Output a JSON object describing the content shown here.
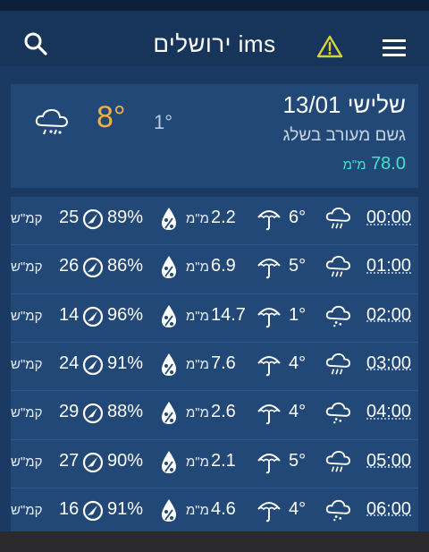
{
  "app": {
    "title": "ims ירושלים",
    "icons": {
      "search": "search-icon",
      "warning": "warning-icon",
      "menu": "menu-icon"
    },
    "colors": {
      "accent_high": "#f3b04a",
      "rain_total": "#3fe6c6",
      "warning": "#d4d33a"
    }
  },
  "summary": {
    "date": "שלישי 13/01",
    "description": "גשם מעורב בשלג",
    "rain_value": "78.0",
    "rain_unit": "מ\"מ",
    "temp_high": "8°",
    "temp_low": "1°",
    "icon": "snow-rain-icon"
  },
  "hours": [
    {
      "time": "00:00",
      "temp": "6°",
      "rain": "2.2",
      "rain_unit": "מ\"מ",
      "humidity": "89%",
      "wind": "25",
      "wind_unit": "קמ\"ש"
    },
    {
      "time": "01:00",
      "temp": "5°",
      "rain": "6.9",
      "rain_unit": "מ\"מ",
      "humidity": "86%",
      "wind": "26",
      "wind_unit": "קמ\"ש"
    },
    {
      "time": "02:00",
      "temp": "1°",
      "rain": "14.7",
      "rain_unit": "מ\"מ",
      "humidity": "96%",
      "wind": "14",
      "wind_unit": "קמ\"ש"
    },
    {
      "time": "03:00",
      "temp": "4°",
      "rain": "7.6",
      "rain_unit": "מ\"מ",
      "humidity": "91%",
      "wind": "24",
      "wind_unit": "קמ\"ש"
    },
    {
      "time": "04:00",
      "temp": "4°",
      "rain": "2.6",
      "rain_unit": "מ\"מ",
      "humidity": "88%",
      "wind": "29",
      "wind_unit": "קמ\"ש"
    },
    {
      "time": "05:00",
      "temp": "5°",
      "rain": "2.1",
      "rain_unit": "מ\"מ",
      "humidity": "90%",
      "wind": "27",
      "wind_unit": "קמ\"ש"
    },
    {
      "time": "06:00",
      "temp": "4°",
      "rain": "4.6",
      "rain_unit": "מ\"מ",
      "humidity": "91%",
      "wind": "16",
      "wind_unit": "קמ\"ש"
    }
  ]
}
